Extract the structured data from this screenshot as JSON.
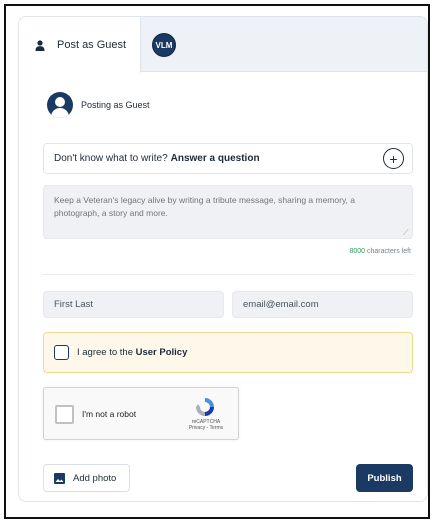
{
  "tabs": {
    "guest_label": "Post as Guest",
    "vlm_label": "VLM"
  },
  "posting": {
    "label": "Posting as Guest"
  },
  "prompt": {
    "question_text": "Don't know what to write?",
    "question_link": "Answer a question",
    "plus_icon": "plus-circle-icon"
  },
  "message": {
    "placeholder": "Keep a Veteran's legacy alive by writing a tribute message, sharing a memory, a photograph, a story and more.",
    "chars_left_count": "8000",
    "chars_left_suffix": " characters left"
  },
  "form": {
    "name_placeholder": "First Last",
    "email_placeholder": "email@email.com",
    "agree_prefix": "I agree to the",
    "agree_link": "User Policy"
  },
  "captcha": {
    "label": "I'm not a robot",
    "brand": "reCAPTCHA",
    "links": "Privacy - Terms"
  },
  "actions": {
    "add_photo_label": "Add photo",
    "publish_label": "Publish"
  },
  "colors": {
    "primary": "#1b3a63",
    "agree_bg": "#fdf8ea",
    "agree_border": "#f0d98e",
    "chars_count": "#2e9a5a"
  }
}
